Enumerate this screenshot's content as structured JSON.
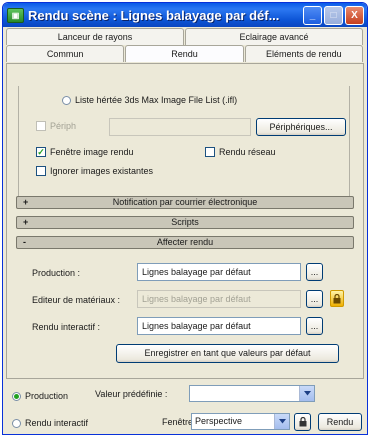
{
  "window": {
    "title": "Rendu scène : Lignes balayage par déf..."
  },
  "title_buttons": {
    "minimize": "_",
    "maximize": "□",
    "close": "X"
  },
  "tabs": {
    "row1": [
      "Lanceur de rayons",
      "Eclairage avancé"
    ],
    "row2": [
      "Commun",
      "Rendu",
      "Eléments de rendu"
    ],
    "active": "Rendu"
  },
  "common_rollout": {
    "file_list_label": "Liste hértée 3ds Max Image File List (.ifl)",
    "peripheral_label": "Périph",
    "peripheral_button": "Périphériques...",
    "frame_window_label": "Fenêtre image rendu",
    "frame_window_checked": true,
    "net_render_label": "Rendu réseau",
    "net_render_checked": false,
    "skip_existing_label": "Ignorer images existantes",
    "skip_existing_checked": false
  },
  "rollouts": [
    {
      "sign": "+",
      "label": "Notification par courrier électronique"
    },
    {
      "sign": "+",
      "label": "Scripts"
    },
    {
      "sign": "-",
      "label": "Affecter rendu"
    }
  ],
  "assign_renderer": {
    "production_label": "Production :",
    "production_value": "Lignes balayage par défaut",
    "material_editor_label": "Editeur de matériaux :",
    "material_editor_value": "Lignes balayage par défaut",
    "activeshade_label": "Rendu interactif :",
    "activeshade_value": "Lignes balayage par défaut",
    "browse_label": "...",
    "save_defaults": "Enregistrer en tant que valeurs par défaut"
  },
  "bottom": {
    "production_radio": "Production",
    "production_selected": true,
    "preset_label": "Valeur prédéfinie :",
    "preset_value": "",
    "activeshade_radio": "Rendu interactif",
    "viewport_label": "Fenêtre :",
    "viewport_value": "Perspective",
    "render_button": "Rendu"
  },
  "colors": {
    "title_bar": "#0a5ae8",
    "panel": "#ece9d8",
    "lock_accent": "#f0b000"
  }
}
